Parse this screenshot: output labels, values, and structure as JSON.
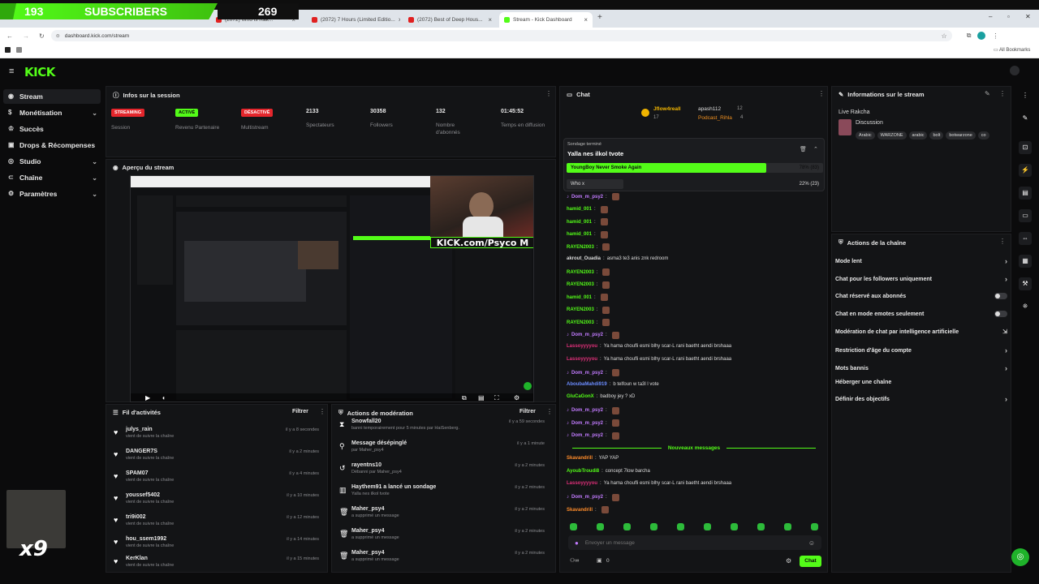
{
  "overlay": {
    "subs_left": "193",
    "subs_label": "SUBSCRIBERS",
    "subs_right": "269",
    "streak": "x9"
  },
  "browser": {
    "tabs": [
      {
        "label": "(2072) Who is Rak...",
        "type": "yt"
      },
      {
        "label": "(2072) 7 Hours (Limited Editio...",
        "type": "yt"
      },
      {
        "label": "(2072) Best of Deep Hous...",
        "type": "yt"
      },
      {
        "label": "Stream - Kick Dashboard",
        "type": "kick"
      }
    ],
    "url": "dashboard.kick.com/stream",
    "bookmarks_label": "All Bookmarks"
  },
  "header": {
    "logo": "KICK"
  },
  "sidebar": {
    "items": [
      {
        "label": "Stream",
        "icon": "radio-icon",
        "chev": false
      },
      {
        "label": "Monétisation",
        "icon": "money-icon",
        "chev": true
      },
      {
        "label": "Succès",
        "icon": "trophy-icon",
        "chev": false
      },
      {
        "label": "Drops & Récompenses",
        "icon": "gift-icon",
        "chev": false
      },
      {
        "label": "Studio",
        "icon": "studio-icon",
        "chev": true
      },
      {
        "label": "Chaîne",
        "icon": "link-icon",
        "chev": true
      },
      {
        "label": "Paramètres",
        "icon": "gear-icon",
        "chev": true
      }
    ]
  },
  "session": {
    "title": "Infos sur la session",
    "streaming_badge": "STREAMING",
    "streaming_label": "Session",
    "revenue_badge": "ACTIVÉ",
    "revenue_label": "Revenu Partenaire",
    "multistream_badge": "DÉSACTIVÉ",
    "multistream_label": "Multistream",
    "spectators": "2133",
    "spectators_label": "Spectateurs",
    "followers": "30358",
    "followers_label": "Followers",
    "subs": "132",
    "subs_label": "Nombre d'abonnés",
    "duration": "01:45:52",
    "duration_label": "Temps en diffusion"
  },
  "preview": {
    "title": "Aperçu du stream",
    "cam_text": "KICK.com/Psyco M"
  },
  "activity": {
    "title": "Fil d'activités",
    "filter": "Filtrer",
    "rows": [
      {
        "name": "julys_rain",
        "sub": "vient de suivre la chaîne",
        "time": "il y a 8 secondes"
      },
      {
        "name": "DANGER7S",
        "sub": "vient de suivre la chaîne",
        "time": "il y a 2 minutes"
      },
      {
        "name": "SPAM07",
        "sub": "vient de suivre la chaîne",
        "time": "il y a 4 minutes"
      },
      {
        "name": "youssef5402",
        "sub": "vient de suivre la chaîne",
        "time": "il y a 10 minutes"
      },
      {
        "name": "tri9i002",
        "sub": "vient de suivre la chaîne",
        "time": "il y a 12 minutes"
      },
      {
        "name": "hou_ssem1992",
        "sub": "vient de suivre la chaîne",
        "time": "il y a 14 minutes"
      },
      {
        "name": "KerKlan",
        "sub": "vient de suivre la chaîne",
        "time": "il y a 15 minutes"
      }
    ]
  },
  "moderation": {
    "title": "Actions de modération",
    "filter": "Filtrer",
    "rows": [
      {
        "name": "Snowfall20",
        "sub": "banni temporairement pour 5 minutes par HaiSenberg.",
        "time": "il y a 59 secondes",
        "icon": "hourglass-icon"
      },
      {
        "name": "Message désépinglé",
        "sub": "par Maher_psy4",
        "time": "il y a 1 minute",
        "icon": "unpin-icon"
      },
      {
        "name": "rayentns10",
        "sub": "Débanni par Maher_psy4",
        "time": "il y a 2 minutes",
        "icon": "unban-icon"
      },
      {
        "name": "Haythem91 a lancé un sondage",
        "sub": "Yalla nes ilkol tvote",
        "time": "il y a 2 minutes",
        "icon": "poll-icon"
      },
      {
        "name": "Maher_psy4",
        "sub": "a supprimé un message",
        "time": "il y a 2 minutes",
        "icon": "trash-icon"
      },
      {
        "name": "Maher_psy4",
        "sub": "a supprimé un message",
        "time": "il y a 2 minutes",
        "icon": "trash-icon"
      },
      {
        "name": "Maher_psy4",
        "sub": "a supprimé un message",
        "time": "il y a 2 minutes",
        "icon": "trash-icon"
      }
    ]
  },
  "chat": {
    "title": "Chat",
    "top_users": [
      "Jflow4reall",
      "apash112",
      "Podcast_Rihla"
    ],
    "top_counts": [
      "12",
      "4",
      "17"
    ],
    "poll": {
      "status": "Sondage terminé",
      "question": "Yalla nes ilkol tvote",
      "options": [
        {
          "label": "YoungBoy Never Smoke Again",
          "result": "78% (83)",
          "pct": 78
        },
        {
          "label": "Who x",
          "result": "22% (23)",
          "pct": 22
        }
      ]
    },
    "messages": [
      {
        "user": "Dom_m_psy2",
        "text": "",
        "color": "#c27bff"
      },
      {
        "user": "hamid_001",
        "text": "",
        "color": "#53fc18"
      },
      {
        "user": "hamid_001",
        "text": "",
        "color": "#53fc18"
      },
      {
        "user": "hamid_001",
        "text": "",
        "color": "#53fc18"
      },
      {
        "user": "RAYEN2003",
        "text": "",
        "color": "#53fc18"
      },
      {
        "user": "akrout_Ouadia",
        "text": "asma3 te3 anis znk redroom",
        "color": "#dddddd"
      },
      {
        "user": "RAYEN2003",
        "text": "",
        "color": "#53fc18"
      },
      {
        "user": "RAYEN2003",
        "text": "",
        "color": "#53fc18"
      },
      {
        "user": "hamid_001",
        "text": "",
        "color": "#53fc18"
      },
      {
        "user": "RAYEN2003",
        "text": "",
        "color": "#53fc18"
      },
      {
        "user": "RAYEN2003",
        "text": "",
        "color": "#53fc18"
      },
      {
        "user": "Dom_m_psy2",
        "text": "",
        "color": "#c27bff"
      },
      {
        "user": "Lassoyyyyou",
        "text": "Ya hama choufli esmi blhy scar-L rani baetht aendi brshaaa",
        "color": "#e0307a"
      },
      {
        "user": "Lassoyyyyou",
        "text": "Ya hama choufli esmi blhy scar-L rani baetht aendi brshaaa",
        "color": "#e0307a"
      },
      {
        "user": "Dom_m_psy2",
        "text": "",
        "color": "#c27bff"
      },
      {
        "user": "AboubaMahdi919",
        "text": "b telfoun w ta3l l vote",
        "color": "#6b8cff"
      },
      {
        "user": "GluCaGonX",
        "text": "badboy jey ? xD",
        "color": "#53fc18"
      },
      {
        "user": "Dom_m_psy2",
        "text": "",
        "color": "#c27bff"
      },
      {
        "user": "Dom_m_psy2",
        "text": "",
        "color": "#c27bff"
      },
      {
        "user": "Dom_m_psy2",
        "text": "",
        "color": "#c27bff"
      }
    ],
    "new_messages": "Nouveaux messages",
    "new_list": [
      {
        "user": "Skavandrill",
        "text": "YAP YAP",
        "color": "#ff8c2a"
      },
      {
        "user": "AyoubTroudi8",
        "text": "concept 7low barcha",
        "color": "#53fc18"
      },
      {
        "user": "Lassoyyyyou",
        "text": "Ya hama choufli esmi blhy scar-L rani baetht aendi brshaaa",
        "color": "#e0307a"
      },
      {
        "user": "Dom_m_psy2",
        "text": "",
        "color": "#c27bff"
      },
      {
        "user": "Skavandrill",
        "text": "",
        "color": "#ff8c2a"
      }
    ],
    "input_placeholder": "Envoyer un message",
    "send_label": "Chat",
    "footer_count": "0"
  },
  "stream_info": {
    "title": "Informations sur le stream",
    "stream_title": "Live Rakcha",
    "category": "Discussion",
    "tags": [
      "Arabic",
      "WARZONE",
      "arabic",
      "bolt",
      "botwarzone",
      "co"
    ]
  },
  "channel_actions": {
    "title": "Actions de la chaîne",
    "items": [
      {
        "label": "Mode lent",
        "ctrl": "arrow"
      },
      {
        "label": "Chat pour les followers uniquement",
        "ctrl": "arrow"
      },
      {
        "label": "Chat réservé aux abonnés",
        "ctrl": "toggle"
      },
      {
        "label": "Chat en mode emotes seulement",
        "ctrl": "toggle"
      },
      {
        "label": "Modération de chat par intelligence artificielle",
        "ctrl": "link"
      },
      {
        "label": "Restriction d'âge du compte",
        "ctrl": "arrow"
      },
      {
        "label": "Mots bannis",
        "ctrl": "arrow"
      },
      {
        "label": "Héberger une chaîne",
        "ctrl": "none"
      },
      {
        "label": "Définir des objectifs",
        "ctrl": "arrow"
      }
    ]
  },
  "colors": {
    "kick_green": "#53fc18",
    "panel": "#131416",
    "bg": "#0b0b0c",
    "red_badge": "#e4262c"
  }
}
